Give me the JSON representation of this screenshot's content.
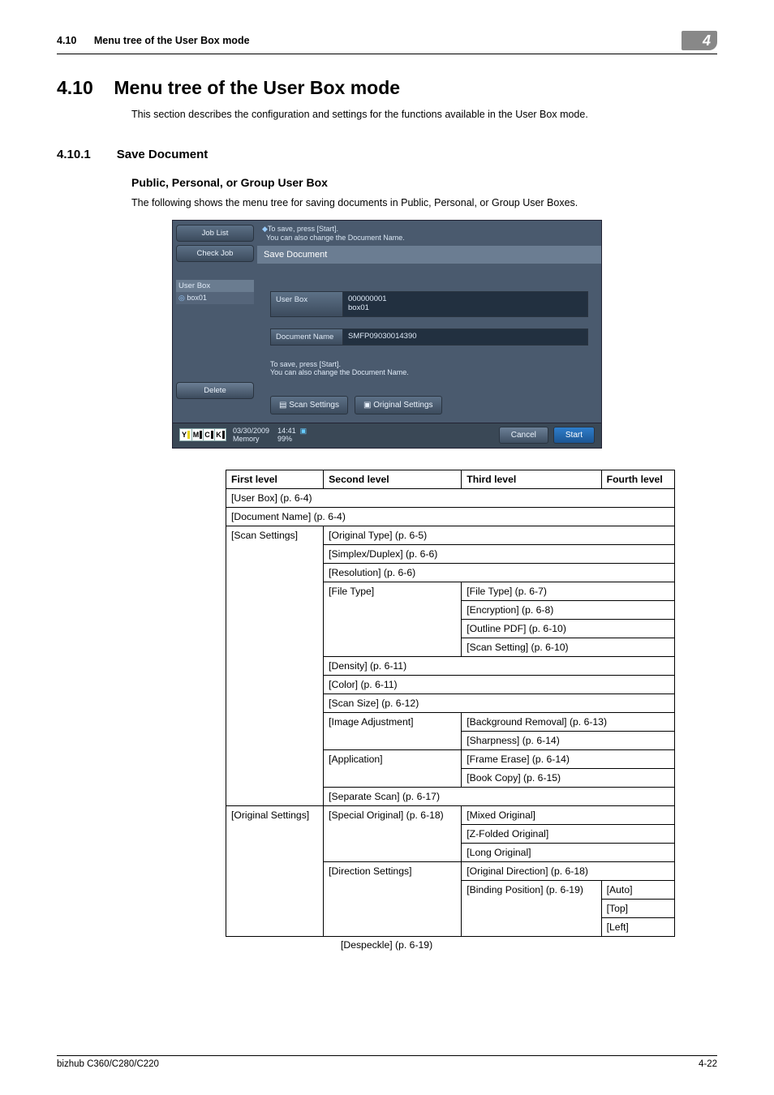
{
  "header": {
    "section": "4.10",
    "title": "Menu tree of the User Box mode",
    "chapter": "4"
  },
  "h1_number": "4.10",
  "h1_title": "Menu tree of the User Box mode",
  "intro": "This section describes the configuration and settings for the functions available in the User Box mode.",
  "sub1_number": "4.10.1",
  "sub1_title": "Save Document",
  "sub2_title": "Public, Personal, or Group User Box",
  "sub2_intro": "The following shows the menu tree for saving documents in Public, Personal, or Group User Boxes.",
  "mfp": {
    "sidebar": {
      "job_list": "Job List",
      "check_job": "Check Job",
      "user_box_label": "User Box",
      "box_item": "box01",
      "delete": "Delete"
    },
    "hint_line1": "To save, press [Start].",
    "hint_line2": "You can also change the Document Name.",
    "panel_title": "Save Document",
    "user_box_label": "User Box",
    "user_box_val_num": "000000001",
    "user_box_val_name": "box01",
    "doc_name_label": "Document Name",
    "doc_name_val": "SMFP09030014390",
    "note_line1": "To save, press [Start].",
    "note_line2": "You can also change the Document Name.",
    "scan_settings": "Scan Settings",
    "original_settings": "Original Settings",
    "leds": {
      "y": "Y",
      "m": "M",
      "c": "C",
      "k": "K"
    },
    "foot_date": "03/30/2009",
    "foot_time": "14:41",
    "foot_mem_label": "Memory",
    "foot_mem_val": "99%",
    "cancel": "Cancel",
    "start": "Start"
  },
  "tree_headers": {
    "l1": "First level",
    "l2": "Second level",
    "l3": "Third level",
    "l4": "Fourth level"
  },
  "tree": {
    "r1": "[User Box] (p. 6-4)",
    "r2": "[Document Name] (p. 6-4)",
    "scan_settings": "[Scan Settings]",
    "original_type": "[Original Type] (p. 6-5)",
    "simplex": "[Simplex/Duplex] (p. 6-6)",
    "resolution": "[Resolution] (p. 6-6)",
    "file_type": "[File Type]",
    "file_type3": "[File Type] (p. 6-7)",
    "encryption": "[Encryption] (p. 6-8)",
    "outline_pdf": "[Outline PDF] (p. 6-10)",
    "scan_setting": "[Scan Setting] (p. 6-10)",
    "density": "[Density] (p. 6-11)",
    "color": "[Color] (p. 6-11)",
    "scan_size": "[Scan Size] (p. 6-12)",
    "image_adjust": "[Image Adjustment]",
    "bg_removal": "[Background Removal] (p. 6-13)",
    "sharpness": "[Sharpness] (p. 6-14)",
    "application": "[Application]",
    "frame_erase": "[Frame Erase] (p. 6-14)",
    "book_copy": "[Book Copy] (p. 6-15)",
    "separate_scan": "[Separate Scan] (p. 6-17)",
    "original_settings": "[Original Settings]",
    "special_original": "[Special Original] (p. 6-18)",
    "mixed_original": "[Mixed Original]",
    "z_folded": "[Z-Folded Original]",
    "long_original": "[Long Original]",
    "direction_settings": "[Direction Settings]",
    "original_direction": "[Original Direction] (p. 6-18)",
    "binding_position": "[Binding Position] (p. 6-19)",
    "auto": "[Auto]",
    "top": "[Top]",
    "left": "[Left]",
    "despeckle": "[Despeckle] (p. 6-19)"
  },
  "footer": {
    "model": "bizhub C360/C280/C220",
    "page": "4-22"
  }
}
